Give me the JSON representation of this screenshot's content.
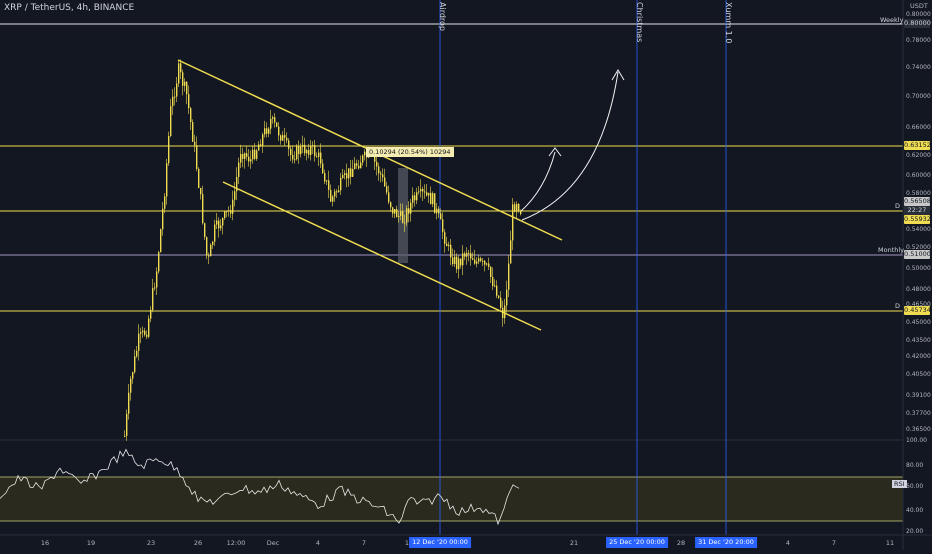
{
  "header": {
    "title": "XRP / TetherUS, 4h, BINANCE"
  },
  "price_axis": {
    "currency": "USDT",
    "ticks": [
      "0.80000",
      "0.78000",
      "0.74000",
      "0.70000",
      "0.66000",
      "0.62000",
      "0.60000",
      "0.58000",
      "0.54000",
      "0.52000",
      "0.50000",
      "0.48000",
      "0.46500",
      "0.45000",
      "0.43500",
      "0.42000",
      "0.40500",
      "0.39100",
      "0.37700",
      "0.36500"
    ]
  },
  "price_labels": {
    "weekly": "0.80000",
    "upper": "0.63152",
    "current": "0.56508",
    "countdown": "22:27",
    "daily_upper": "0.55932",
    "monthly": "0.51000",
    "daily_lower": "0.45734"
  },
  "level_tags": {
    "weekly": "Weekly",
    "monthly": "Monthly",
    "daily_upper": "D",
    "daily_lower": "D"
  },
  "events": {
    "airdrop": "Airdrop",
    "christmas": "Christmas",
    "xumm": "Xumm 1.0"
  },
  "measure": {
    "text": "0.10294 (20.54%) 10294"
  },
  "rsi": {
    "label": "RSI",
    "ticks": [
      "100.00",
      "80.00",
      "60.00",
      "40.00",
      "20.00"
    ]
  },
  "time_axis": {
    "ticks": [
      "16",
      "19",
      "23",
      "26",
      "12:00",
      "Dec",
      "4",
      "7",
      "10",
      "14",
      "21",
      "28",
      "4",
      "7",
      "11"
    ],
    "boxes": [
      "12 Dec '20  00:00",
      "25 Dec '20  00:00",
      "31 Dec '20  20:00"
    ]
  },
  "colors": {
    "background": "#131722",
    "candle": "#f0dc50",
    "level": "#f0dc50",
    "monthly": "#a695c8",
    "event": "#2962ff",
    "rsi_band": "#2a2a1e"
  },
  "chart_data": {
    "type": "candlestick",
    "title": "XRP / TetherUS, 4h, BINANCE",
    "series_close_approx": [
      0.36,
      0.43,
      0.46,
      0.54,
      0.66,
      0.74,
      0.7,
      0.62,
      0.52,
      0.58,
      0.66,
      0.64,
      0.62,
      0.58,
      0.61,
      0.59,
      0.56,
      0.52,
      0.49,
      0.47,
      0.46,
      0.51,
      0.565
    ],
    "horizontal_levels": [
      0.8,
      0.63152,
      0.55932,
      0.51,
      0.45734
    ],
    "ylim": [
      0.36,
      0.8
    ],
    "rsi_ylim": [
      20,
      100
    ]
  }
}
